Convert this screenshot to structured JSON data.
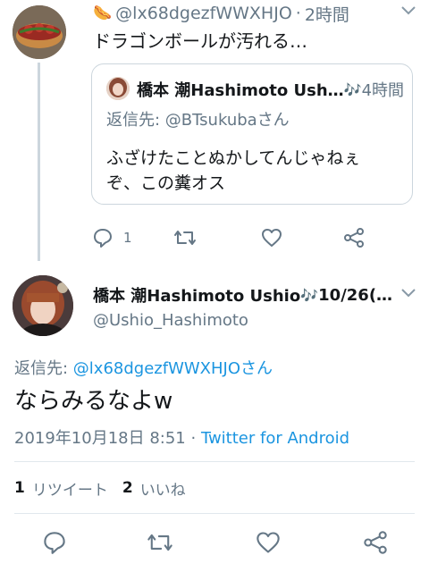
{
  "reply_tweet": {
    "emoji": "🌭",
    "handle": "@lx68dgezfWWXHJO",
    "separator": "·",
    "time": "2時間",
    "text": "ドラゴンボールが汚れる…",
    "quote": {
      "name": "橋本 潮Hashimoto Ush…",
      "note_emoji": "🎶",
      "time": "4時間",
      "reply_prefix": "返信先: ",
      "reply_to": "@BTsukuba",
      "reply_suffix": "さん",
      "text_line1": "ふざけたことぬかしてんじゃねぇ",
      "text_line2": "ぞ、この糞オス"
    },
    "reply_count": "1"
  },
  "main_tweet": {
    "name": "橋本 潮Hashimoto Ushio",
    "note_emoji": "🎶",
    "date_short": "10/26(…",
    "username": "@Ushio_Hashimoto",
    "reply_prefix": "返信先: ",
    "reply_to": "@lx68dgezfWWXHJO",
    "reply_suffix": "さん",
    "text": "ならみるなよw",
    "timestamp": "2019年10月18日 8:51 · ",
    "source": "Twitter for Android",
    "retweets_count": "1",
    "retweets_label": "リツイート",
    "likes_count": "2",
    "likes_label": "いいね"
  },
  "colors": {
    "link_blue": "#1b95e0",
    "secondary_grey": "#657786",
    "icon_grey": "#657786",
    "divider": "#e1e8ed"
  }
}
